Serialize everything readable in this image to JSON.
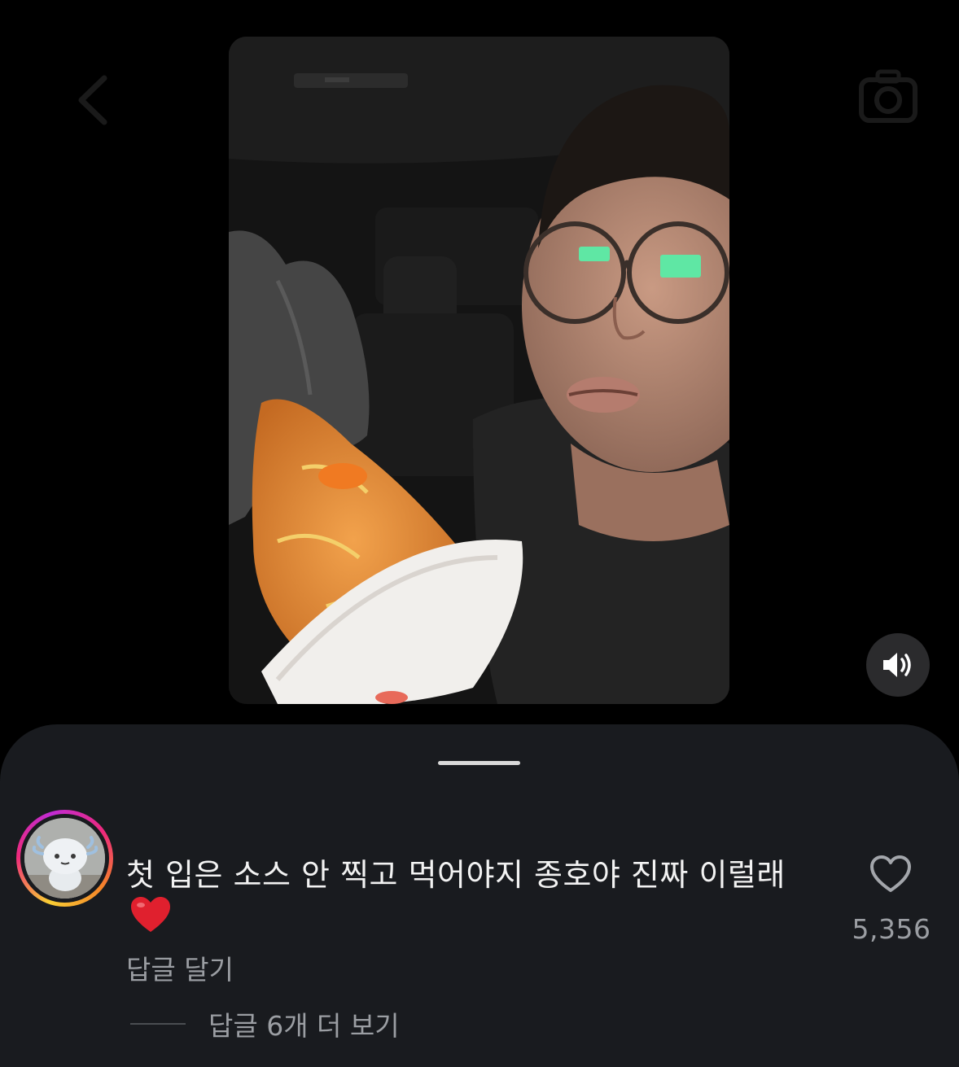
{
  "comment": {
    "text": "첫 입은 소스 안 찍고 먹어야지 종호야 진짜 이럴래",
    "emoji": "red-heart-emoji",
    "reply_label": "답글 달기",
    "view_replies_label": "답글 6개 더 보기",
    "like_count": "5,356"
  },
  "icons": {
    "back": "chevron-left-icon",
    "camera": "camera-icon",
    "mute": "speaker-icon",
    "like": "heart-outline-icon"
  },
  "colors": {
    "background": "#000000",
    "sheet": "#191b1f",
    "secondary_text": "#9b9ea3",
    "primary_text": "#f2f2f2",
    "emoji_heart": "#e0202e"
  }
}
